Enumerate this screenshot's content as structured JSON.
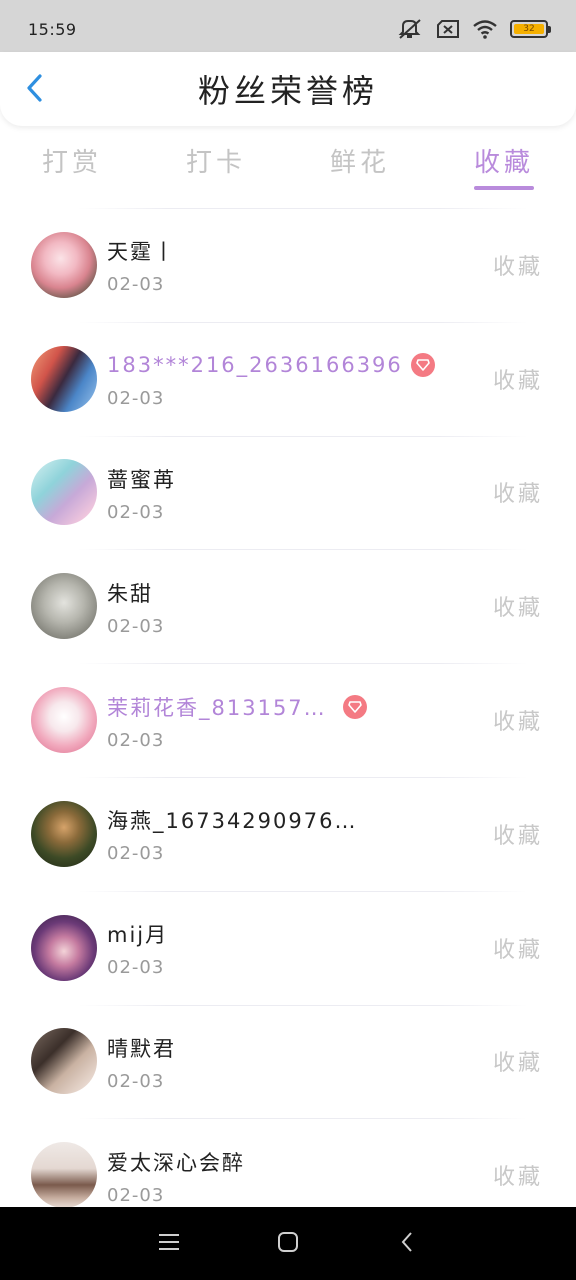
{
  "status_bar": {
    "time": "15:59",
    "battery_level": "32",
    "icons": [
      "mute-vibrate-icon",
      "no-sim-icon",
      "wifi-icon",
      "battery-icon"
    ]
  },
  "header": {
    "title": "粉丝荣誉榜",
    "back_icon": "chevron-left-icon"
  },
  "tabs": [
    {
      "label": "打赏",
      "active": false
    },
    {
      "label": "打卡",
      "active": false
    },
    {
      "label": "鲜花",
      "active": false
    },
    {
      "label": "收藏",
      "active": true
    }
  ],
  "colors": {
    "accent": "#b98bdc",
    "vip_name": "#b285d8",
    "vip_badge": "#f47a83",
    "inactive_tab": "#c4c4c4"
  },
  "fans": [
    {
      "name": "天霆丨",
      "date": "02-03",
      "action": "收藏",
      "vip": false,
      "avatar": "rose-flower-avatar"
    },
    {
      "name": "183***216_2636166396",
      "date": "02-03",
      "action": "收藏",
      "vip": true,
      "avatar": "anime-girls-avatar"
    },
    {
      "name": "蔷蜜苒",
      "date": "02-03",
      "action": "收藏",
      "vip": false,
      "avatar": "anime-mermaid-avatar"
    },
    {
      "name": "朱甜",
      "date": "02-03",
      "action": "收藏",
      "vip": false,
      "avatar": "white-flowers-avatar"
    },
    {
      "name": "茉莉花香_813157…",
      "date": "02-03",
      "action": "收藏",
      "vip": true,
      "avatar": "white-cat-avatar"
    },
    {
      "name": "海燕_16734290976…",
      "date": "02-03",
      "action": "收藏",
      "vip": false,
      "avatar": "kid-outdoor-avatar"
    },
    {
      "name": "mij月",
      "date": "02-03",
      "action": "收藏",
      "vip": false,
      "avatar": "anime-doll-avatar"
    },
    {
      "name": "晴默君",
      "date": "02-03",
      "action": "收藏",
      "vip": false,
      "avatar": "portrait-avatar"
    },
    {
      "name": "爱太深心会醉",
      "date": "02-03",
      "action": "收藏",
      "vip": false,
      "avatar": "beach-girl-avatar"
    }
  ],
  "nav_bar": {
    "icons": [
      "menu-icon",
      "home-square-icon",
      "back-chevron-icon"
    ]
  }
}
